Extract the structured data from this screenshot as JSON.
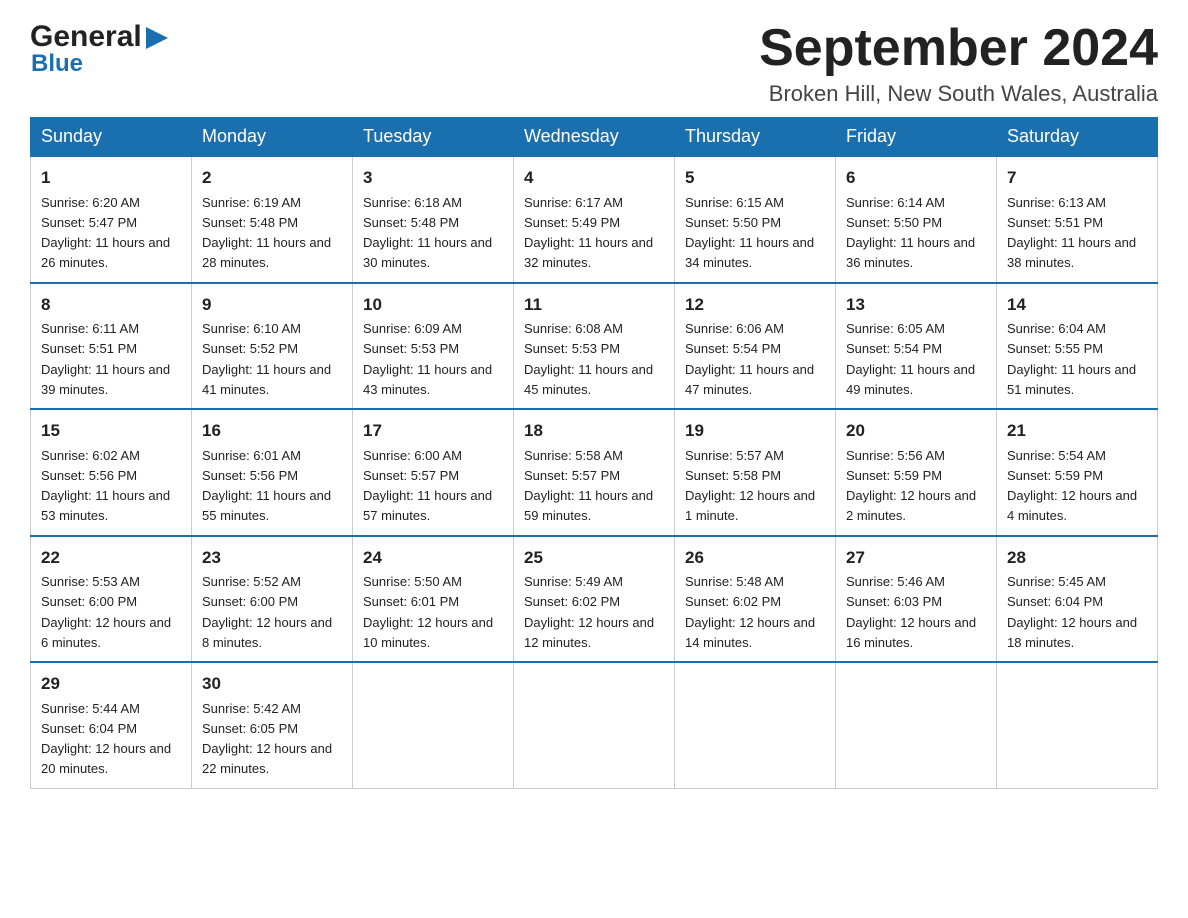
{
  "header": {
    "logo_line1": "General",
    "logo_line2": "Blue",
    "month_title": "September 2024",
    "location": "Broken Hill, New South Wales, Australia"
  },
  "days_of_week": [
    "Sunday",
    "Monday",
    "Tuesday",
    "Wednesday",
    "Thursday",
    "Friday",
    "Saturday"
  ],
  "weeks": [
    [
      {
        "day": "1",
        "sunrise": "6:20 AM",
        "sunset": "5:47 PM",
        "daylight": "11 hours and 26 minutes."
      },
      {
        "day": "2",
        "sunrise": "6:19 AM",
        "sunset": "5:48 PM",
        "daylight": "11 hours and 28 minutes."
      },
      {
        "day": "3",
        "sunrise": "6:18 AM",
        "sunset": "5:48 PM",
        "daylight": "11 hours and 30 minutes."
      },
      {
        "day": "4",
        "sunrise": "6:17 AM",
        "sunset": "5:49 PM",
        "daylight": "11 hours and 32 minutes."
      },
      {
        "day": "5",
        "sunrise": "6:15 AM",
        "sunset": "5:50 PM",
        "daylight": "11 hours and 34 minutes."
      },
      {
        "day": "6",
        "sunrise": "6:14 AM",
        "sunset": "5:50 PM",
        "daylight": "11 hours and 36 minutes."
      },
      {
        "day": "7",
        "sunrise": "6:13 AM",
        "sunset": "5:51 PM",
        "daylight": "11 hours and 38 minutes."
      }
    ],
    [
      {
        "day": "8",
        "sunrise": "6:11 AM",
        "sunset": "5:51 PM",
        "daylight": "11 hours and 39 minutes."
      },
      {
        "day": "9",
        "sunrise": "6:10 AM",
        "sunset": "5:52 PM",
        "daylight": "11 hours and 41 minutes."
      },
      {
        "day": "10",
        "sunrise": "6:09 AM",
        "sunset": "5:53 PM",
        "daylight": "11 hours and 43 minutes."
      },
      {
        "day": "11",
        "sunrise": "6:08 AM",
        "sunset": "5:53 PM",
        "daylight": "11 hours and 45 minutes."
      },
      {
        "day": "12",
        "sunrise": "6:06 AM",
        "sunset": "5:54 PM",
        "daylight": "11 hours and 47 minutes."
      },
      {
        "day": "13",
        "sunrise": "6:05 AM",
        "sunset": "5:54 PM",
        "daylight": "11 hours and 49 minutes."
      },
      {
        "day": "14",
        "sunrise": "6:04 AM",
        "sunset": "5:55 PM",
        "daylight": "11 hours and 51 minutes."
      }
    ],
    [
      {
        "day": "15",
        "sunrise": "6:02 AM",
        "sunset": "5:56 PM",
        "daylight": "11 hours and 53 minutes."
      },
      {
        "day": "16",
        "sunrise": "6:01 AM",
        "sunset": "5:56 PM",
        "daylight": "11 hours and 55 minutes."
      },
      {
        "day": "17",
        "sunrise": "6:00 AM",
        "sunset": "5:57 PM",
        "daylight": "11 hours and 57 minutes."
      },
      {
        "day": "18",
        "sunrise": "5:58 AM",
        "sunset": "5:57 PM",
        "daylight": "11 hours and 59 minutes."
      },
      {
        "day": "19",
        "sunrise": "5:57 AM",
        "sunset": "5:58 PM",
        "daylight": "12 hours and 1 minute."
      },
      {
        "day": "20",
        "sunrise": "5:56 AM",
        "sunset": "5:59 PM",
        "daylight": "12 hours and 2 minutes."
      },
      {
        "day": "21",
        "sunrise": "5:54 AM",
        "sunset": "5:59 PM",
        "daylight": "12 hours and 4 minutes."
      }
    ],
    [
      {
        "day": "22",
        "sunrise": "5:53 AM",
        "sunset": "6:00 PM",
        "daylight": "12 hours and 6 minutes."
      },
      {
        "day": "23",
        "sunrise": "5:52 AM",
        "sunset": "6:00 PM",
        "daylight": "12 hours and 8 minutes."
      },
      {
        "day": "24",
        "sunrise": "5:50 AM",
        "sunset": "6:01 PM",
        "daylight": "12 hours and 10 minutes."
      },
      {
        "day": "25",
        "sunrise": "5:49 AM",
        "sunset": "6:02 PM",
        "daylight": "12 hours and 12 minutes."
      },
      {
        "day": "26",
        "sunrise": "5:48 AM",
        "sunset": "6:02 PM",
        "daylight": "12 hours and 14 minutes."
      },
      {
        "day": "27",
        "sunrise": "5:46 AM",
        "sunset": "6:03 PM",
        "daylight": "12 hours and 16 minutes."
      },
      {
        "day": "28",
        "sunrise": "5:45 AM",
        "sunset": "6:04 PM",
        "daylight": "12 hours and 18 minutes."
      }
    ],
    [
      {
        "day": "29",
        "sunrise": "5:44 AM",
        "sunset": "6:04 PM",
        "daylight": "12 hours and 20 minutes."
      },
      {
        "day": "30",
        "sunrise": "5:42 AM",
        "sunset": "6:05 PM",
        "daylight": "12 hours and 22 minutes."
      },
      null,
      null,
      null,
      null,
      null
    ]
  ]
}
